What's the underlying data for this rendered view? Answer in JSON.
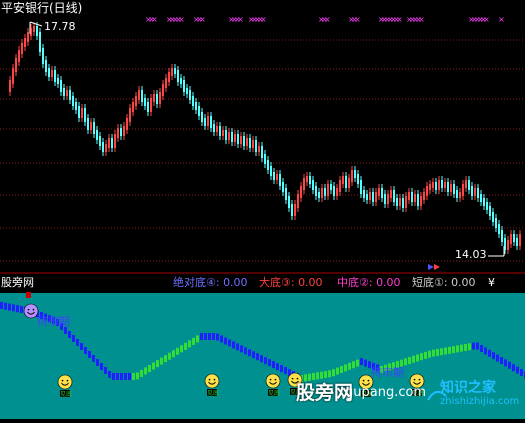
{
  "price_panel": {
    "title": "平安银行(日线)",
    "high_label": "17.78",
    "low_label": "14.03"
  },
  "indicator_panel": {
    "name": "股旁网",
    "legend": [
      {
        "label": "绝对底④: 0.00",
        "color": "#6f6fff"
      },
      {
        "label": "大底③: 0.00",
        "color": "#ff4040"
      },
      {
        "label": "中底②: 0.00",
        "color": "#ff3fd0"
      },
      {
        "label": "短底①: 0.00",
        "color": "#cccccc"
      }
    ],
    "yen": "¥",
    "zone_labels": [
      "待市期",
      "待市期"
    ],
    "smiley_tag": "见底"
  },
  "watermark": {
    "main": "股旁网",
    "url": "gupang.com",
    "brand": "知识之家",
    "brand_sub": "zhishizhijia.com"
  },
  "colors": {
    "up": "#ff4444",
    "down": "#54ffff",
    "teal": "#009090",
    "blue_band": "#2020ff",
    "green_band": "#33dd33",
    "grid": "#8b1a1a",
    "magenta_marks": "#ff40ff"
  }
}
